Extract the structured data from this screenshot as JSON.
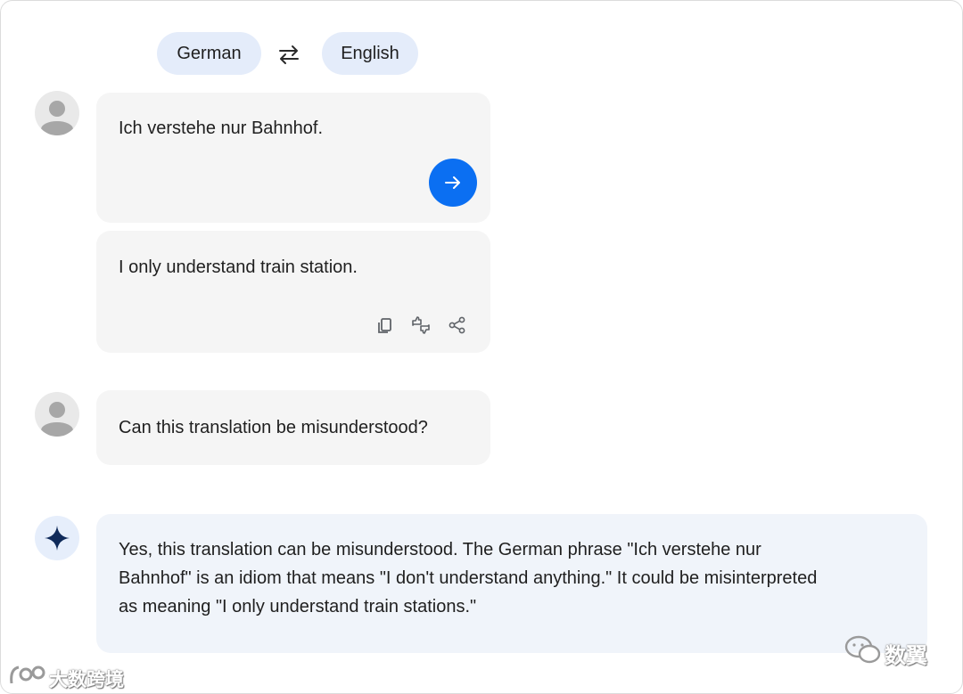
{
  "language_bar": {
    "source": "German",
    "target": "English",
    "swap_icon": "swap-arrows-icon"
  },
  "conversation": {
    "input": {
      "text": "Ich verstehe nur Bahnhof.",
      "send_icon": "arrow-right-icon"
    },
    "translation": {
      "text": "I only understand train station.",
      "actions": [
        "copy-icon",
        "thumbs-up-down-icon",
        "share-icon"
      ]
    },
    "user_question": {
      "text": "Can this translation be misunderstood?"
    },
    "assistant_answer": {
      "lines": [
        "Yes, this translation can be misunderstood. The German phrase \"Ich verstehe nur",
        "Bahnhof\" is an idiom that means \"I don't understand anything.\" It could be misinterpreted",
        "as meaning \"I only understand train stations.\""
      ],
      "icon": "sparkle-icon"
    }
  },
  "watermarks": {
    "bottom_left": "大数跨境",
    "bottom_right": "数翼"
  },
  "colors": {
    "pill_bg": "#e4ecfa",
    "send_button": "#0b6ff2",
    "bubble_bg": "#f5f5f5",
    "answer_bg": "#f0f4fa",
    "sparkle": "#0f2a5a"
  }
}
